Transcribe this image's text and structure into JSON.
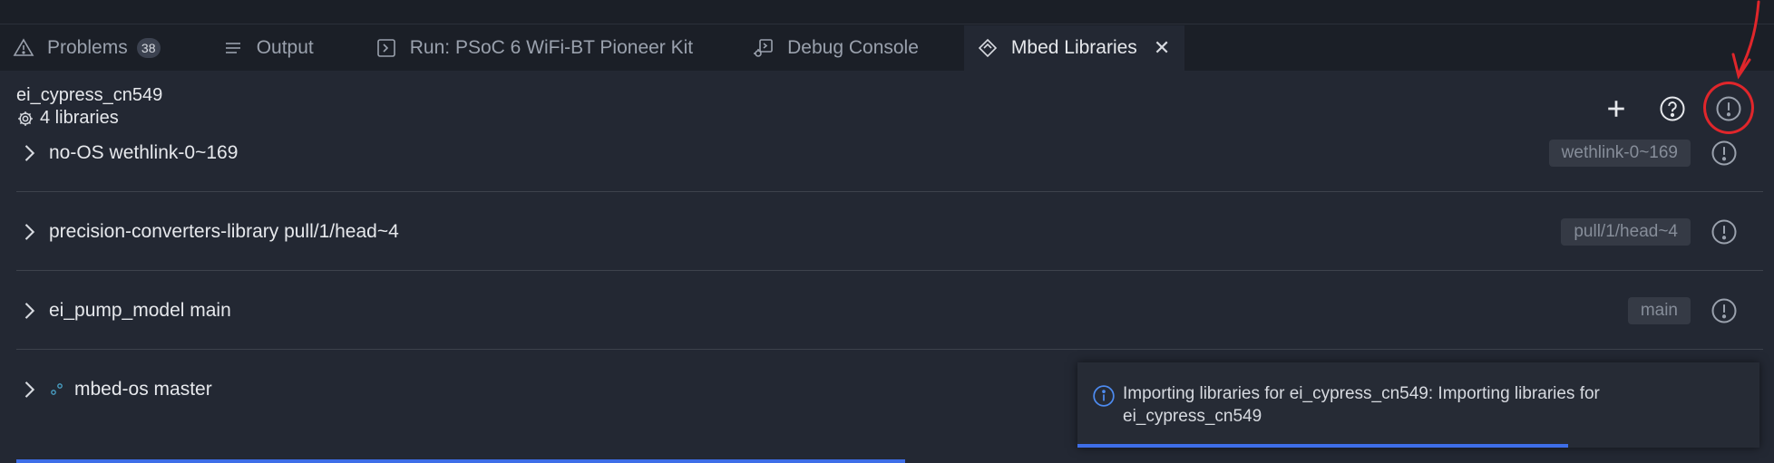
{
  "tabs": [
    {
      "label": "Problems",
      "icon": "warning-icon",
      "badge": "38"
    },
    {
      "label": "Output",
      "icon": "list-icon"
    },
    {
      "label": "Run: PSoC 6 WiFi-BT Pioneer Kit",
      "icon": "terminal-icon"
    },
    {
      "label": "Debug Console",
      "icon": "debug-console-icon"
    },
    {
      "label": "Mbed Libraries",
      "icon": "mbed-icon",
      "active": true
    }
  ],
  "project": {
    "name": "ei_cypress_cn549",
    "library_count": "4 libraries"
  },
  "header_actions": [
    "add-icon",
    "help-icon",
    "info-icon"
  ],
  "libraries": [
    {
      "label": "no-OS wethlink-0~169",
      "ref": "wethlink-0~169"
    },
    {
      "label": "precision-converters-library pull/1/head~4",
      "ref": "pull/1/head~4"
    },
    {
      "label": "ei_pump_model main",
      "ref": "main"
    },
    {
      "label": "mbed-os master",
      "ref": ""
    }
  ],
  "toast": {
    "message": "Importing libraries for ei_cypress_cn549: Importing libraries for ei_cypress_cn549",
    "progress": 0.72
  },
  "colors": {
    "accent": "#3e6ee8",
    "annotation": "#e0262b",
    "background": "#232833"
  }
}
